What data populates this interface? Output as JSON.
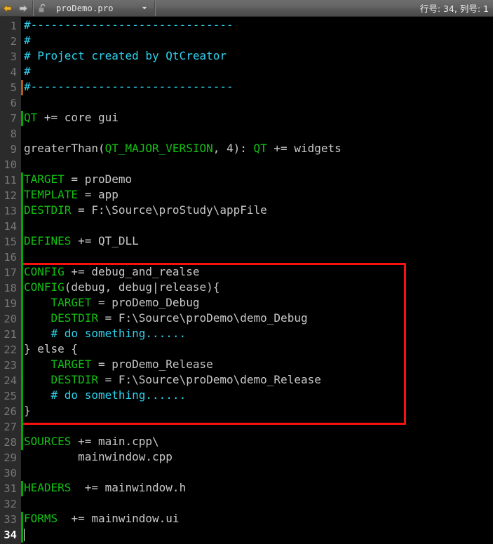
{
  "window": {
    "title": "proDemo.pro"
  },
  "toolbar": {
    "back_icon": "back-arrow-icon",
    "forward_icon": "forward-arrow-icon",
    "lock_icon": "unlocked-padlock-icon",
    "filename": "proDemo.pro",
    "dropdown_icon": "chevron-down-icon",
    "status": "行号: 34, 列号: 1"
  },
  "cursor": {
    "line": 34,
    "column": 1
  },
  "annotation": {
    "color": "#fb1010",
    "covers_lines": "17-26"
  },
  "colors": {
    "editor_background": "#000000",
    "gutter_background": "#2b2b2b",
    "line_number": "#787878",
    "current_line_number": "#ffffff",
    "keyword": "#12c212",
    "comment": "#2fd2ee",
    "text": "#c8c8c8",
    "change_bar": "#00aa00",
    "change_bar_alt": "#b05c18",
    "toolbar_text": "#e8e8e8"
  },
  "editor": {
    "lines": [
      {
        "n": 1,
        "change": null,
        "tokens": [
          {
            "t": "#------------------------------",
            "c": "cm"
          }
        ]
      },
      {
        "n": 2,
        "change": null,
        "tokens": [
          {
            "t": "#",
            "c": "cm"
          }
        ]
      },
      {
        "n": 3,
        "change": null,
        "tokens": [
          {
            "t": "# Project created by QtCreator",
            "c": "cm"
          }
        ]
      },
      {
        "n": 4,
        "change": null,
        "tokens": [
          {
            "t": "#",
            "c": "cm"
          }
        ]
      },
      {
        "n": 5,
        "change": "orange",
        "tokens": [
          {
            "t": "#------------------------------",
            "c": "cm"
          }
        ]
      },
      {
        "n": 6,
        "change": null,
        "tokens": []
      },
      {
        "n": 7,
        "change": "green",
        "tokens": [
          {
            "t": "QT",
            "c": "kw"
          },
          {
            "t": " += core gui",
            "c": "tx"
          }
        ]
      },
      {
        "n": 8,
        "change": null,
        "tokens": []
      },
      {
        "n": 9,
        "change": null,
        "tokens": [
          {
            "t": "greaterThan(",
            "c": "tx"
          },
          {
            "t": "QT_MAJOR_VERSION",
            "c": "kw"
          },
          {
            "t": ", 4): ",
            "c": "tx"
          },
          {
            "t": "QT",
            "c": "kw"
          },
          {
            "t": " += widgets",
            "c": "tx"
          }
        ]
      },
      {
        "n": 10,
        "change": null,
        "tokens": []
      },
      {
        "n": 11,
        "change": "green",
        "tokens": [
          {
            "t": "TARGET",
            "c": "kw"
          },
          {
            "t": " = proDemo",
            "c": "tx"
          }
        ]
      },
      {
        "n": 12,
        "change": "green",
        "tokens": [
          {
            "t": "TEMPLATE",
            "c": "kw"
          },
          {
            "t": " = app",
            "c": "tx"
          }
        ]
      },
      {
        "n": 13,
        "change": "green",
        "tokens": [
          {
            "t": "DESTDIR",
            "c": "kw"
          },
          {
            "t": " = F:\\Source\\proStudy\\appFile",
            "c": "tx"
          }
        ]
      },
      {
        "n": 14,
        "change": "green",
        "tokens": []
      },
      {
        "n": 15,
        "change": "green",
        "tokens": [
          {
            "t": "DEFINES",
            "c": "kw"
          },
          {
            "t": " += QT_DLL",
            "c": "tx"
          }
        ]
      },
      {
        "n": 16,
        "change": "green",
        "tokens": []
      },
      {
        "n": 17,
        "change": "green",
        "tokens": [
          {
            "t": "CONFIG",
            "c": "kw"
          },
          {
            "t": " += debug_and_realse",
            "c": "tx"
          }
        ]
      },
      {
        "n": 18,
        "change": "green",
        "tokens": [
          {
            "t": "CONFIG",
            "c": "kw"
          },
          {
            "t": "(debug, debug|release){",
            "c": "tx"
          }
        ]
      },
      {
        "n": 19,
        "change": "green",
        "tokens": [
          {
            "t": "    ",
            "c": "tx"
          },
          {
            "t": "TARGET",
            "c": "kw"
          },
          {
            "t": " = proDemo_Debug",
            "c": "tx"
          }
        ]
      },
      {
        "n": 20,
        "change": "green",
        "tokens": [
          {
            "t": "    ",
            "c": "tx"
          },
          {
            "t": "DESTDIR",
            "c": "kw"
          },
          {
            "t": " = F:\\Source\\proDemo\\demo_Debug",
            "c": "tx"
          }
        ]
      },
      {
        "n": 21,
        "change": "green",
        "tokens": [
          {
            "t": "    ",
            "c": "tx"
          },
          {
            "t": "# do something......",
            "c": "cm"
          }
        ]
      },
      {
        "n": 22,
        "change": "green",
        "tokens": [
          {
            "t": "} else {",
            "c": "tx"
          }
        ]
      },
      {
        "n": 23,
        "change": "green",
        "tokens": [
          {
            "t": "    ",
            "c": "tx"
          },
          {
            "t": "TARGET",
            "c": "kw"
          },
          {
            "t": " = proDemo_Release",
            "c": "tx"
          }
        ]
      },
      {
        "n": 24,
        "change": "green",
        "tokens": [
          {
            "t": "    ",
            "c": "tx"
          },
          {
            "t": "DESTDIR",
            "c": "kw"
          },
          {
            "t": " = F:\\Source\\proDemo\\demo_Release",
            "c": "tx"
          }
        ]
      },
      {
        "n": 25,
        "change": "green",
        "tokens": [
          {
            "t": "    ",
            "c": "tx"
          },
          {
            "t": "# do something......",
            "c": "cm"
          }
        ]
      },
      {
        "n": 26,
        "change": "green",
        "tokens": [
          {
            "t": "}",
            "c": "tx"
          }
        ]
      },
      {
        "n": 27,
        "change": "green",
        "tokens": []
      },
      {
        "n": 28,
        "change": "green",
        "tokens": [
          {
            "t": "SOURCES",
            "c": "kw"
          },
          {
            "t": " += main.cpp\\",
            "c": "tx"
          }
        ]
      },
      {
        "n": 29,
        "change": null,
        "tokens": [
          {
            "t": "        mainwindow.cpp",
            "c": "tx"
          }
        ]
      },
      {
        "n": 30,
        "change": null,
        "tokens": []
      },
      {
        "n": 31,
        "change": "green",
        "tokens": [
          {
            "t": "HEADERS",
            "c": "kw"
          },
          {
            "t": "  += mainwindow.h",
            "c": "tx"
          }
        ]
      },
      {
        "n": 32,
        "change": null,
        "tokens": []
      },
      {
        "n": 33,
        "change": "green",
        "tokens": [
          {
            "t": "FORMS",
            "c": "kw"
          },
          {
            "t": "  += mainwindow.ui",
            "c": "tx"
          }
        ]
      },
      {
        "n": 34,
        "change": "green",
        "tokens": [],
        "current": true
      }
    ]
  }
}
